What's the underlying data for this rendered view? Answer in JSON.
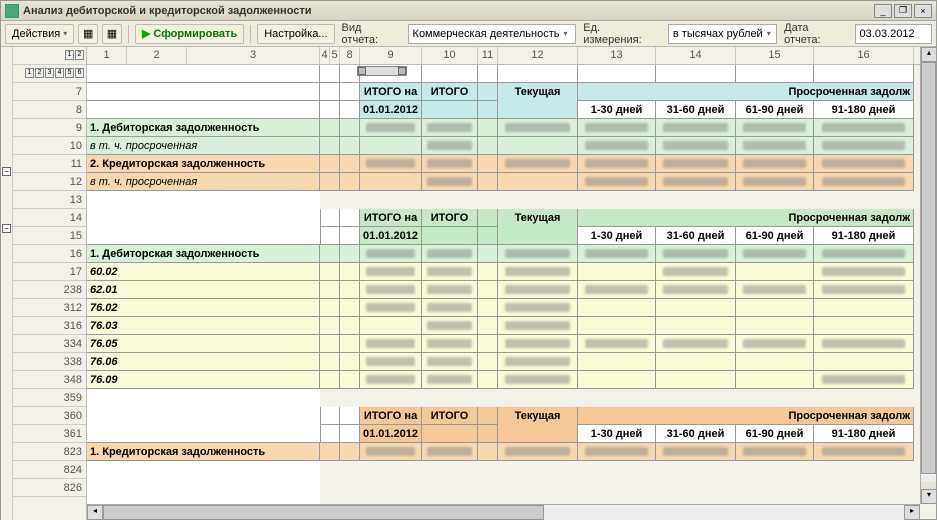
{
  "window": {
    "title": "Анализ дебиторской и кредиторской задолженности"
  },
  "toolbar": {
    "actions": "Действия",
    "run": "Сформировать",
    "settings": "Настройка...",
    "report_type_lbl": "Вид отчета:",
    "report_type": "Коммерческая деятельность",
    "unit_lbl": "Ед. измерения:",
    "unit": "в тысячах рублей",
    "date_lbl": "Дата отчета:",
    "date": "03.03.2012"
  },
  "cols": {
    "c1": "1",
    "c2": "2",
    "c3": "3",
    "c4": "4",
    "c5": "5",
    "c8": "8",
    "c9": "9",
    "c10": "10",
    "c11": "11",
    "c12": "12",
    "c13": "13",
    "c14": "14",
    "c15": "15",
    "c16": "16"
  },
  "levels_v": [
    "1",
    "2"
  ],
  "levels_h": [
    "1",
    "2",
    "3",
    "4",
    "5",
    "6"
  ],
  "rows": [
    "7",
    "8",
    "9",
    "10",
    "11",
    "12",
    "13",
    "14",
    "15",
    "16",
    "17",
    "238",
    "312",
    "316",
    "334",
    "338",
    "348",
    "359",
    "360",
    "361",
    "823",
    "824",
    "826"
  ],
  "hdrs": {
    "itogo_on": "ИТОГО на",
    "date": "01.01.2012",
    "itogo": "ИТОГО",
    "current": "Текущая",
    "overdue": "Просроченная задолж",
    "d1": "1-30 дней",
    "d2": "31-60 дней",
    "d3": "61-90 дней",
    "d4": "91-180 дней"
  },
  "labels": {
    "deb": "1. Дебиторская задолженность",
    "deb_over": "в т. ч. просроченная",
    "kred": "2. Кредиторская задолженность",
    "kred_over": "в т. ч. просроченная",
    "kred1": "1. Кредиторская задолженность",
    "a1": "60.02",
    "a2": "62.01",
    "a3": "76.02",
    "a4": "76.03",
    "a5": "76.05",
    "a6": "76.06",
    "a7": "76.09"
  }
}
